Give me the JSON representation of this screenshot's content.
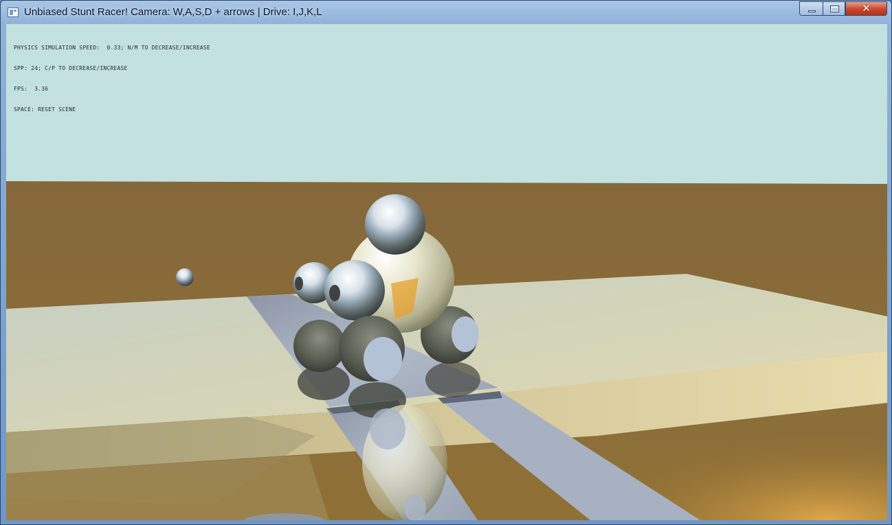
{
  "window": {
    "title": "Unbiased Stunt Racer! Camera: W,A,S,D + arrows | Drive: I,J,K,L",
    "controls": {
      "minimize": "minimize",
      "maximize": "maximize",
      "close": "✕"
    }
  },
  "overlay": {
    "lines": [
      "PHYSICS SIMULATION SPEED:  0.33; N/M TO DECREASE/INCREASE",
      "SPP: 24; C/P TO DECREASE/INCREASE",
      "FPS:  3.36",
      "SPACE: RESET SCENE"
    ]
  },
  "colors": {
    "sky": "#c3e1df",
    "ground": "#8a6e35",
    "platform": "#cfcfb0",
    "platform_front": "#b8a97a",
    "mirror_strip": "#9aa4b6",
    "title_bar": "#9ebbe0",
    "close_button": "#c9452c"
  },
  "scene": {
    "icons": [
      "window-app-icon"
    ]
  }
}
